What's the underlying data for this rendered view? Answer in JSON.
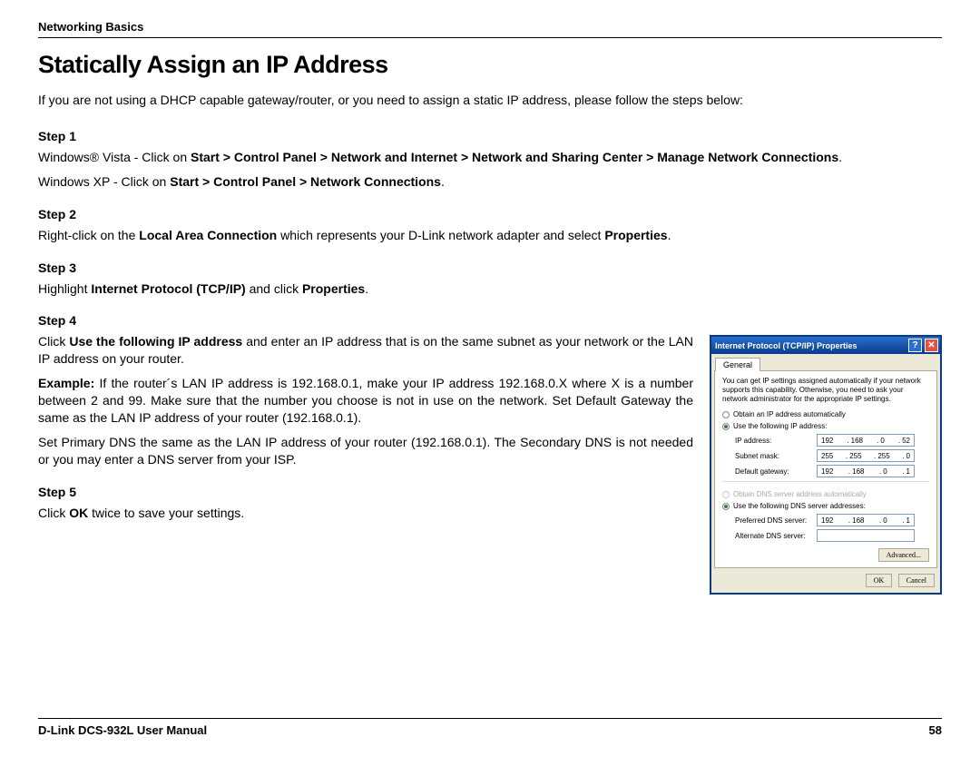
{
  "header": "Networking Basics",
  "title": "Statically Assign an IP Address",
  "intro": "If you are not using a DHCP capable gateway/router, or you need to assign a static IP address, please follow the steps below:",
  "step1": {
    "head": "Step 1",
    "vista_pre": "Windows® Vista - Click on ",
    "vista_path": "Start > Control Panel > Network and Internet > Network and Sharing Center > Manage Network Connections",
    "xp_pre": "Windows XP - Click on ",
    "xp_path": "Start > Control Panel > Network Connections"
  },
  "step2": {
    "head": "Step 2",
    "pre": "Right-click on the ",
    "b1": "Local Area Connection",
    "mid": " which represents your D-Link network adapter and select ",
    "b2": "Properties"
  },
  "step3": {
    "head": "Step 3",
    "pre": "Highlight ",
    "b1": "Internet Protocol (TCP/IP)",
    "mid": " and click ",
    "b2": "Properties"
  },
  "step4": {
    "head": "Step 4",
    "p1_pre": "Click ",
    "p1_b": "Use the following IP address",
    "p1_post": " and enter an IP address that is on the same subnet as your network or the LAN IP address on your router.",
    "ex_b": "Example:",
    "ex_text": " If the router´s LAN IP address is 192.168.0.1, make your IP address 192.168.0.X where X is a number between 2 and 99. Make sure that the number you choose is not in use on the network. Set Default Gateway the same as the LAN IP address of your router (192.168.0.1).",
    "p3": "Set Primary DNS the same as the LAN IP address of your router (192.168.0.1). The Secondary DNS is not needed or you may enter a DNS server from your ISP."
  },
  "step5": {
    "head": "Step 5",
    "pre": "Click ",
    "b1": "OK",
    "post": " twice to save your settings."
  },
  "dialog": {
    "title": "Internet Protocol (TCP/IP) Properties",
    "tab": "General",
    "desc": "You can get IP settings assigned automatically if your network supports this capability. Otherwise, you need to ask your network administrator for the appropriate IP settings.",
    "radio_auto_ip": "Obtain an IP address automatically",
    "radio_use_ip": "Use the following IP address:",
    "ip_label": "IP address:",
    "ip": [
      "192",
      "168",
      "0",
      "52"
    ],
    "mask_label": "Subnet mask:",
    "mask": [
      "255",
      "255",
      "255",
      "0"
    ],
    "gw_label": "Default gateway:",
    "gw": [
      "192",
      "168",
      "0",
      "1"
    ],
    "radio_auto_dns": "Obtain DNS server address automatically",
    "radio_use_dns": "Use the following DNS server addresses:",
    "pdns_label": "Preferred DNS server:",
    "pdns": [
      "192",
      "168",
      "0",
      "1"
    ],
    "adns_label": "Alternate DNS server:",
    "adv": "Advanced...",
    "ok": "OK",
    "cancel": "Cancel"
  },
  "footer": {
    "left": "D-Link DCS-932L User Manual",
    "right": "58"
  }
}
